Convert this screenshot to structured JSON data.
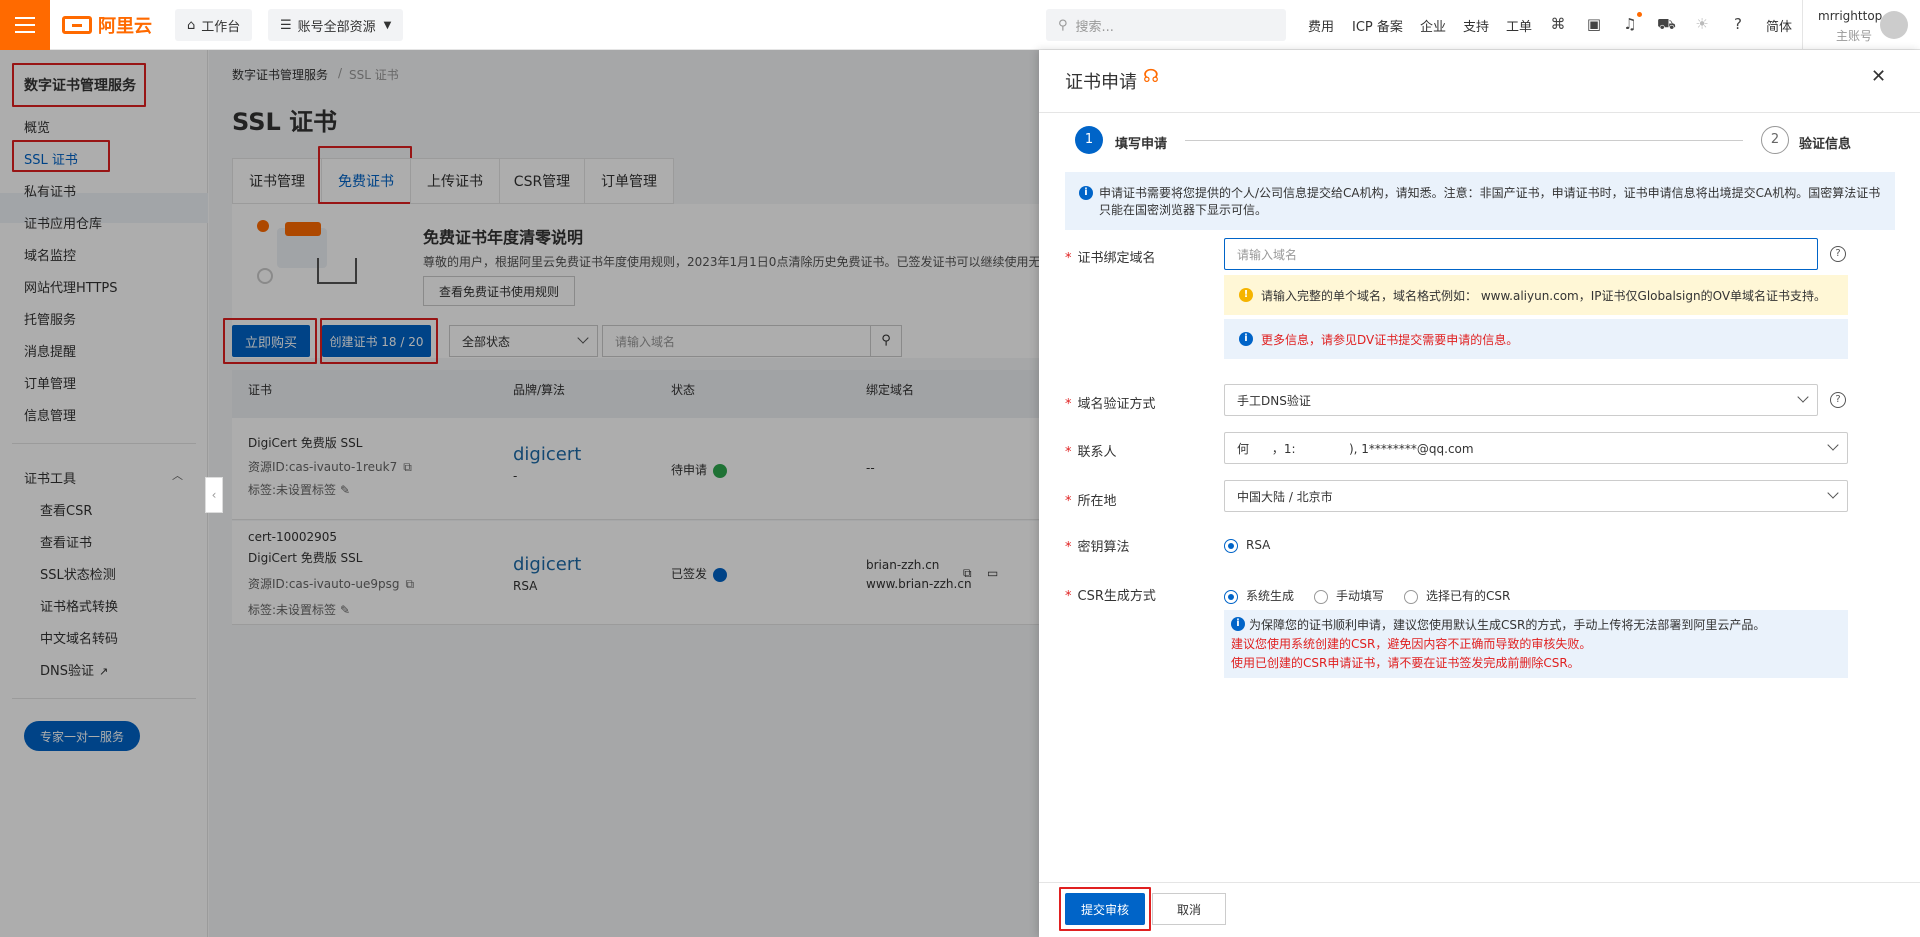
{
  "topbar": {
    "logo_text": "阿里云",
    "workbench": "工作台",
    "resources": "账号全部资源",
    "search_placeholder": "搜索...",
    "links": [
      "费用",
      "ICP 备案",
      "企业",
      "支持",
      "工单"
    ],
    "lang": "简体",
    "username": "mrrighttop",
    "account_type": "主账号"
  },
  "sidebar": {
    "title": "数字证书管理服务",
    "items": [
      "概览",
      "SSL 证书",
      "私有证书",
      "证书应用仓库",
      "域名监控",
      "网站代理HTTPS",
      "托管服务",
      "消息提醒",
      "订单管理",
      "信息管理"
    ],
    "tools_title": "证书工具",
    "tools": [
      "查看CSR",
      "查看证书",
      "SSL状态检测",
      "证书格式转换",
      "中文域名转码",
      "DNS验证"
    ],
    "expert_button": "专家一对一服务"
  },
  "main": {
    "breadcrumb_root": "数字证书管理服务",
    "breadcrumb_current": "SSL 证书",
    "page_title": "SSL 证书",
    "tabs": [
      "证书管理",
      "免费证书",
      "上传证书",
      "CSR管理",
      "订单管理"
    ],
    "notice_title": "免费证书年度清零说明",
    "notice_text": "尊敬的用户，根据阿里云免费证书年度使用规则，2023年1月1日0点清除历史免费证书。已签发证书可以继续使用无任",
    "notice_button": "查看免费证书使用规则",
    "buy_button": "立即购买",
    "create_button": "创建证书 18 / 20",
    "status_filter": "全部状态",
    "domain_search_placeholder": "请输入域名",
    "table_headers": [
      "证书",
      "品牌/算法",
      "状态",
      "绑定域名"
    ],
    "rows": [
      {
        "name": "",
        "type": "DigiCert 免费版 SSL",
        "resource_id": "资源ID:cas-ivauto-1reuk7",
        "tag": "标签:未设置标签",
        "brand": "digicert",
        "algo": "-",
        "status": "待申请",
        "domains": [
          "--"
        ]
      },
      {
        "name": "cert-10002905",
        "type": "DigiCert 免费版 SSL",
        "resource_id": "资源ID:cas-ivauto-ue9psg",
        "tag": "标签:未设置标签",
        "brand": "digicert",
        "algo": "RSA",
        "status": "已签发",
        "domains": [
          "brian-zzh.cn",
          "www.brian-zzh.cn"
        ]
      }
    ]
  },
  "drawer": {
    "title": "证书申请",
    "step1": "填写申请",
    "step1_num": "1",
    "step2": "验证信息",
    "step2_num": "2",
    "info_text": "申请证书需要将您提供的个人/公司信息提交给CA机构，请知悉。注意：非国产证书，申请证书时，证书申请信息将出境提交CA机构。国密算法证书只能在国密浏览器下显示可信。",
    "domain_label": "证书绑定域名",
    "domain_placeholder": "请输入域名",
    "domain_warning": "请输入完整的单个域名，域名格式例如： www.aliyun.com，IP证书仅Globalsign的OV单域名证书支持。",
    "domain_more_info": "更多信息，请参见DV证书提交需要申请的信息。",
    "verify_label": "域名验证方式",
    "verify_value": "手工DNS验证",
    "contact_label": "联系人",
    "contact_value": "何      ，1:              ), 1********@qq.com",
    "location_label": "所在地",
    "location_value": "中国大陆 / 北京市",
    "algo_label": "密钥算法",
    "algo_value": "RSA",
    "csr_label": "CSR生成方式",
    "csr_options": [
      "系统生成",
      "手动填写",
      "选择已有的CSR"
    ],
    "csr_info": "为保障您的证书顺利申请，建议您使用默认生成CSR的方式，手动上传将无法部署到阿里云产品。",
    "csr_warn1": "建议您使用系统创建的CSR，避免因内容不正确而导致的审核失败。",
    "csr_warn2": "使用已创建的CSR申请证书，请不要在证书签发完成前删除CSR。",
    "submit_button": "提交审核",
    "cancel_button": "取消"
  }
}
